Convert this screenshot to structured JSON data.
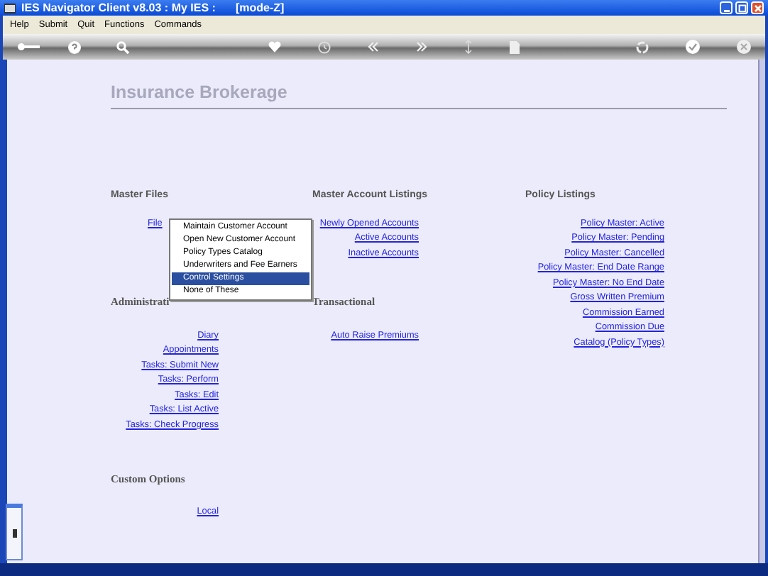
{
  "window": {
    "title": "IES Navigator Client v8.03 : My IES :",
    "mode": "[mode-Z]"
  },
  "menu": [
    "Help",
    "Submit",
    "Quit",
    "Functions",
    "Commands"
  ],
  "page_title": "Insurance Brokerage",
  "columns": [
    {
      "sections": [
        {
          "heading": "Master Files",
          "links": [
            "File"
          ]
        },
        {
          "heading": "Administrati",
          "links": [
            "Diary",
            "Appointments",
            "Tasks: Submit New",
            "Tasks: Perform",
            "Tasks: Edit",
            "Tasks: List Active",
            "Tasks: Check Progress"
          ]
        },
        {
          "heading": "Custom Options",
          "links": [
            "Local"
          ]
        }
      ]
    },
    {
      "sections": [
        {
          "heading": "Master Account Listings",
          "links": [
            "Newly Opened Accounts",
            "Active Accounts",
            "Inactive Accounts"
          ]
        },
        {
          "heading": "Transactional",
          "links": [
            "Auto Raise Premiums"
          ]
        }
      ]
    },
    {
      "sections": [
        {
          "heading": "Policy Listings",
          "links": [
            "Policy Master: Active",
            "Policy Master: Pending",
            "Policy Master: Cancelled",
            "Policy Master: End Date Range",
            "Policy Master: No End Date",
            "Gross Written Premium",
            "Commission Earned",
            "Commission Due",
            "Catalog (Policy Types)"
          ]
        }
      ]
    }
  ],
  "popup_menu": [
    {
      "label": "Maintain Customer Account",
      "selected": false
    },
    {
      "label": "Open New Customer Account",
      "selected": false
    },
    {
      "label": "Policy Types Catalog",
      "selected": false
    },
    {
      "label": "Underwriters and Fee Earners",
      "selected": false
    },
    {
      "label": "Control Settings",
      "selected": true
    },
    {
      "label": "None of These",
      "selected": false
    }
  ]
}
